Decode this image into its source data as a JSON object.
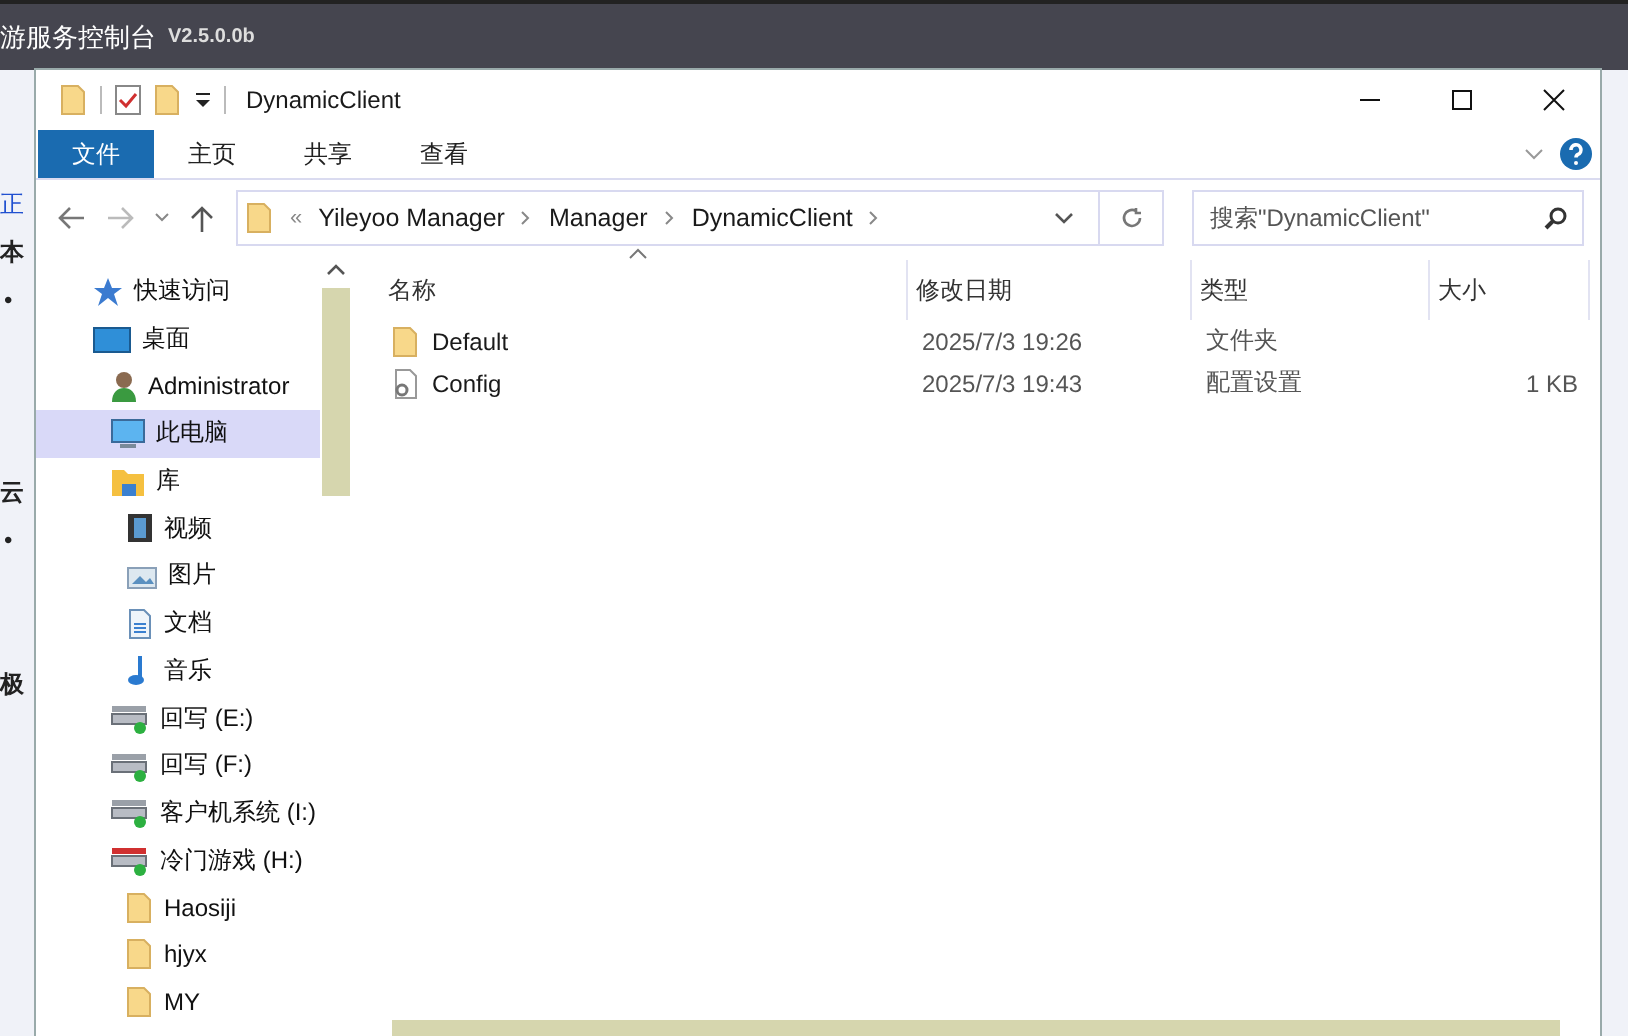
{
  "background_app": {
    "title": "游服务控制台",
    "version": "V2.5.0.0b",
    "items": [
      {
        "text": "正",
        "kind": "link"
      },
      {
        "text": "本",
        "kind": "heading"
      },
      {
        "text": "•",
        "kind": "bullet"
      },
      {
        "text": "云",
        "kind": "heading"
      },
      {
        "text": "•",
        "kind": "bullet"
      },
      {
        "text": "极",
        "kind": "heading"
      }
    ]
  },
  "window": {
    "title": "DynamicClient"
  },
  "ribbon_tabs": [
    {
      "label": "文件",
      "selected": true
    },
    {
      "label": "主页",
      "selected": false
    },
    {
      "label": "共享",
      "selected": false
    },
    {
      "label": "查看",
      "selected": false
    }
  ],
  "address_bar": {
    "prefix": "«",
    "path": [
      "Yileyoo Manager",
      "Manager",
      "DynamicClient"
    ]
  },
  "search": {
    "placeholder": "搜索\"DynamicClient\""
  },
  "nav_tree": [
    {
      "label": "快速访问",
      "kind": "star",
      "selected": false
    },
    {
      "label": "桌面",
      "kind": "desktop",
      "selected": false,
      "children": [
        {
          "label": "Administrator",
          "kind": "user",
          "selected": false
        },
        {
          "label": "此电脑",
          "kind": "pc",
          "selected": true
        },
        {
          "label": "库",
          "kind": "library",
          "selected": false,
          "children": [
            {
              "label": "视频",
              "kind": "video",
              "selected": false
            },
            {
              "label": "图片",
              "kind": "image",
              "selected": false
            },
            {
              "label": "文档",
              "kind": "document",
              "selected": false
            },
            {
              "label": "音乐",
              "kind": "music",
              "selected": false
            }
          ]
        },
        {
          "label": "回写 (E:)",
          "kind": "drive",
          "selected": false
        },
        {
          "label": "回写 (F:)",
          "kind": "drive",
          "selected": false
        },
        {
          "label": "客户机系统 (I:)",
          "kind": "drive",
          "selected": false
        },
        {
          "label": "冷门游戏 (H:)",
          "kind": "alertdrive",
          "selected": false,
          "children": [
            {
              "label": "Haosiji",
              "kind": "folder",
              "selected": false
            },
            {
              "label": "hjyx",
              "kind": "folder",
              "selected": false
            },
            {
              "label": "MY",
              "kind": "folder",
              "selected": false
            }
          ]
        }
      ]
    }
  ],
  "table": {
    "columns": [
      "名称",
      "修改日期",
      "类型",
      "大小"
    ],
    "rows": [
      {
        "name": "Default",
        "kind": "folder",
        "modified": "2025/7/3 19:26",
        "type": "文件夹"
      },
      {
        "name": "Config",
        "kind": "config",
        "modified": "2025/7/3 19:43",
        "type": "配置设置",
        "size": "1 KB"
      }
    ]
  }
}
